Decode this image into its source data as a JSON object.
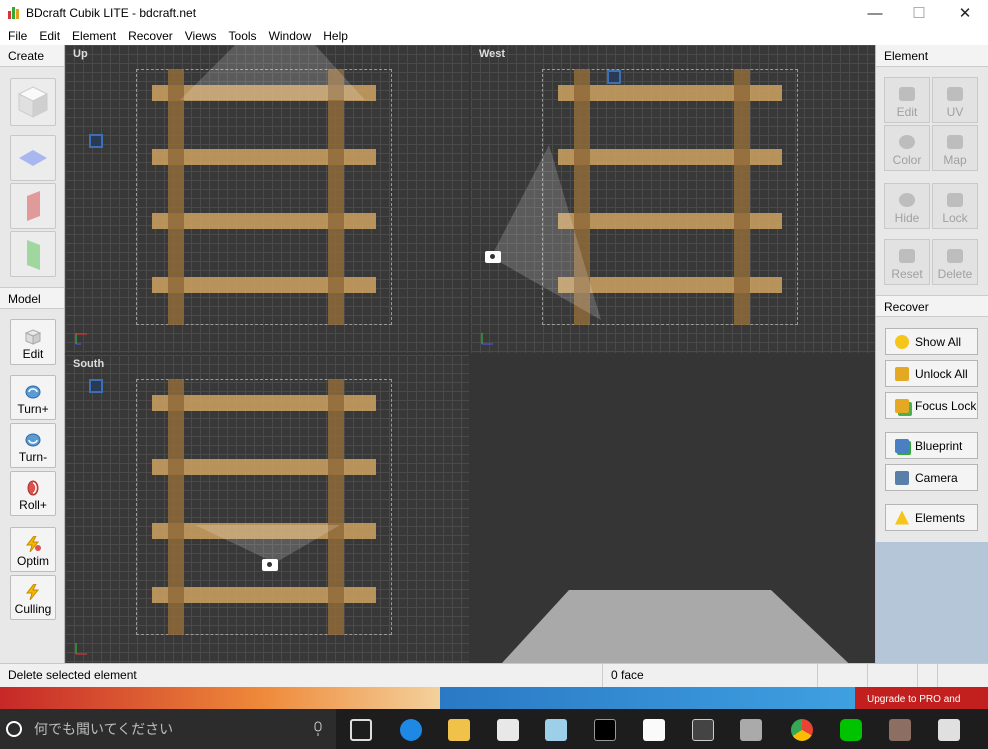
{
  "app": {
    "title": "BDcraft Cubik LITE - bdcraft.net"
  },
  "window_controls": {
    "minimize": "—",
    "maximize": "☐",
    "close": "✕"
  },
  "menu": [
    "File",
    "Edit",
    "Element",
    "Recover",
    "Views",
    "Tools",
    "Window",
    "Help"
  ],
  "left_panel": {
    "create_header": "Create",
    "model_header": "Model",
    "tools": {
      "edit": "Edit",
      "turn_plus": "Turn+",
      "turn_minus": "Turn-",
      "roll_plus": "Roll+",
      "optim": "Optim",
      "culling": "Culling"
    }
  },
  "viewports": {
    "up": "Up",
    "west": "West",
    "south": "South"
  },
  "element_panel": {
    "header": "Element",
    "buttons": {
      "edit": "Edit",
      "uv": "UV",
      "color": "Color",
      "map": "Map",
      "hide": "Hide",
      "lock": "Lock",
      "reset": "Reset",
      "delete": "Delete"
    }
  },
  "recover_panel": {
    "header": "Recover",
    "buttons": {
      "show_all": "Show All",
      "unlock_all": "Unlock All",
      "focus_lock": "Focus Lock",
      "blueprint": "Blueprint",
      "camera": "Camera",
      "elements": "Elements"
    }
  },
  "status": {
    "message": "Delete selected element",
    "faces": "0 face"
  },
  "banner": {
    "text": "Upgrade to PRO and"
  },
  "taskbar": {
    "search_placeholder": "何でも聞いてください"
  }
}
